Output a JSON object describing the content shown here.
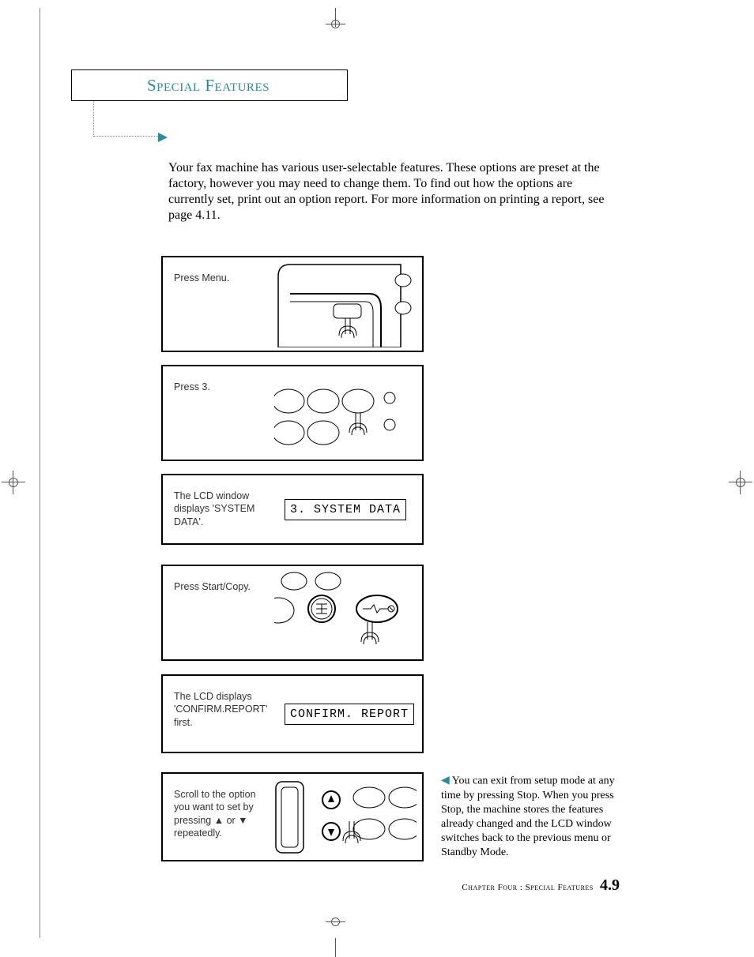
{
  "header": {
    "section_title": "Special Features"
  },
  "intro": "Your fax machine has various user-selectable features. These options are preset at the factory, however you may need to change them. To find out how the options are currently set, print out an option report. For more information on printing a report, see page 4.11.",
  "steps": [
    {
      "type": "image",
      "text": "Press Menu."
    },
    {
      "type": "image",
      "text": "Press 3."
    },
    {
      "type": "lcd",
      "text": "The LCD window displays 'SYSTEM DATA'.",
      "lcd": "3. SYSTEM DATA"
    },
    {
      "type": "image",
      "text": "Press Start/Copy."
    },
    {
      "type": "lcd",
      "text": "The LCD displays 'CONFIRM.REPORT' first.",
      "lcd": "CONFIRM. REPORT"
    },
    {
      "type": "image",
      "text": "Scroll to the option you want to set by pressing ▲ or ▼ repeatedly."
    }
  ],
  "tip": "You can exit from setup mode at any time by pressing Stop. When you press Stop, the machine stores the features already changed and the LCD window switches back to the previous menu or Standby Mode.",
  "footer": {
    "chapter_label": "Chapter Four : Special Features",
    "page_number": "4.9"
  }
}
